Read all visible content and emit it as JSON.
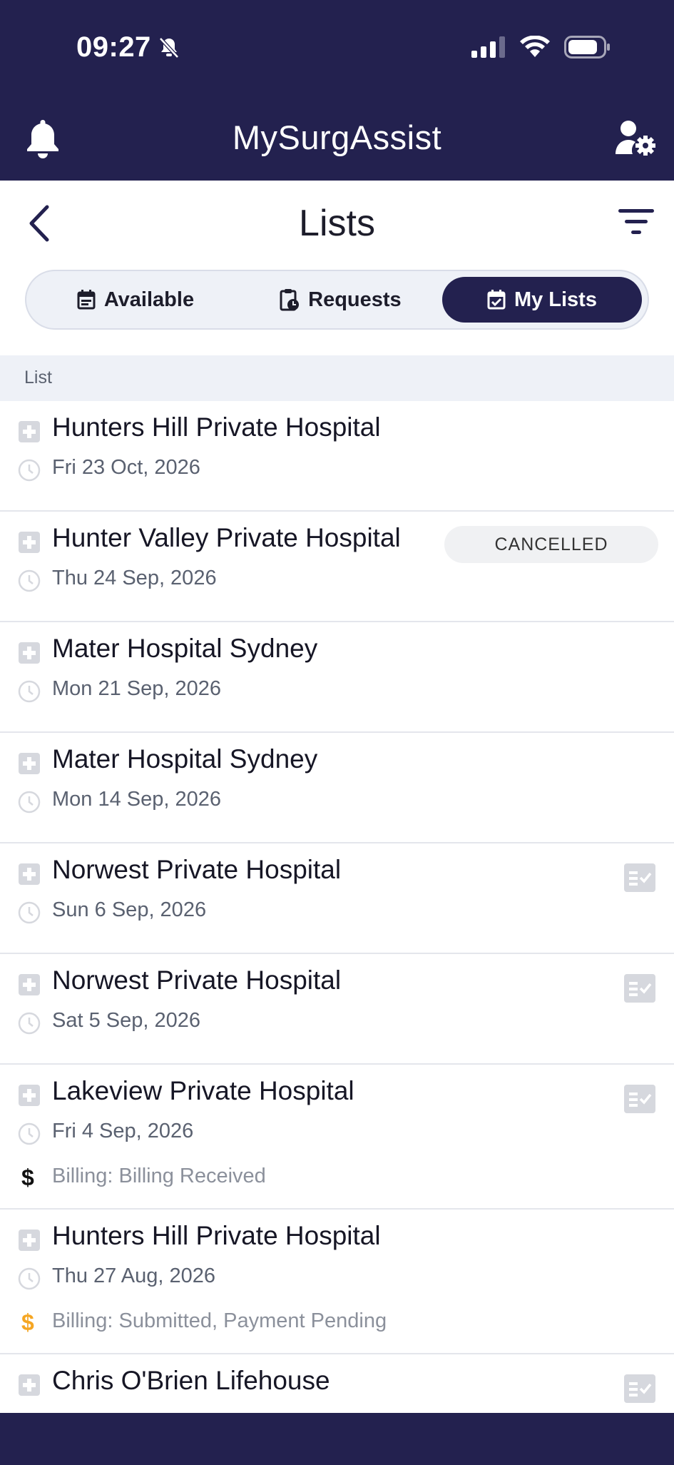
{
  "status": {
    "time": "09:27"
  },
  "header": {
    "app_title": "MySurgAssist"
  },
  "page": {
    "title": "Lists"
  },
  "tabs": [
    {
      "label": "Available"
    },
    {
      "label": "Requests"
    },
    {
      "label": "My Lists"
    }
  ],
  "list": {
    "header": "List",
    "rows": [
      {
        "name": "Hunters Hill Private Hospital",
        "date": "Fri 23 Oct, 2026"
      },
      {
        "name": "Hunter Valley Private Hospital",
        "date": "Thu 24 Sep, 2026",
        "badge": "CANCELLED"
      },
      {
        "name": "Mater Hospital Sydney",
        "date": "Mon 21 Sep, 2026"
      },
      {
        "name": "Mater Hospital Sydney",
        "date": "Mon 14 Sep, 2026"
      },
      {
        "name": "Norwest Private Hospital",
        "date": "Sun 6 Sep, 2026"
      },
      {
        "name": "Norwest Private Hospital",
        "date": "Sat 5 Sep, 2026"
      },
      {
        "name": "Lakeview Private Hospital",
        "date": "Fri 4 Sep, 2026",
        "billing_symbol": "$",
        "billing": "Billing: Billing Received"
      },
      {
        "name": "Hunters Hill Private Hospital",
        "date": "Thu 27 Aug, 2026",
        "billing_symbol": "$",
        "billing": "Billing: Submitted, Payment Pending"
      },
      {
        "name": "Chris O'Brien Lifehouse"
      }
    ]
  },
  "colors": {
    "brand_navy": "#23214f",
    "billing_received": "#111111",
    "billing_pending": "#f5a623"
  }
}
